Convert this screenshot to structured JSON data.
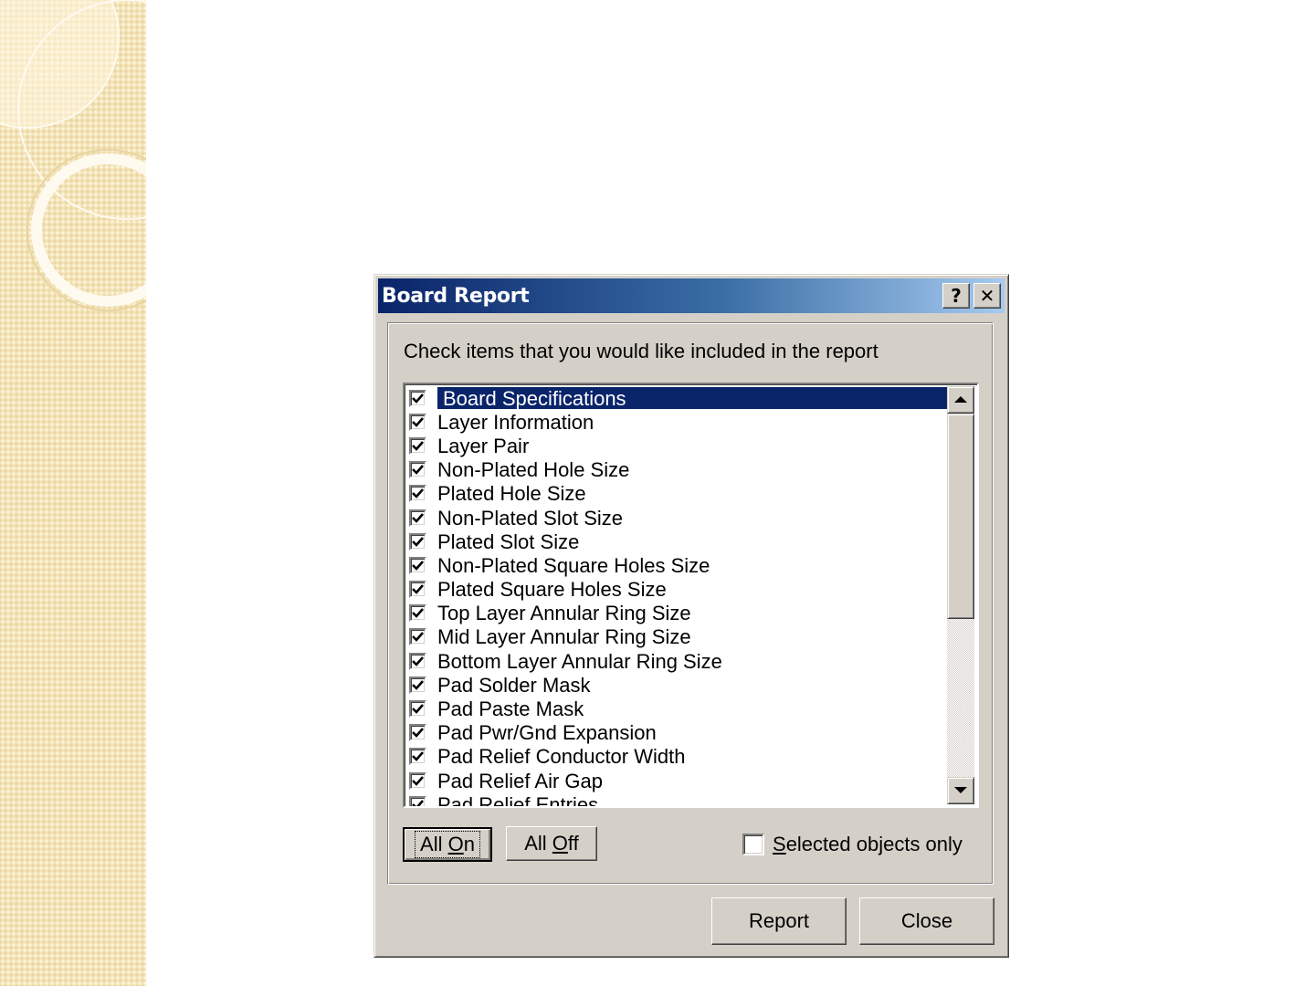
{
  "dialog": {
    "title": "Board Report",
    "help_glyph": "?",
    "close_glyph": "✕",
    "instruction": "Check items that you would like included in the report",
    "items": [
      {
        "label": "Board Specifications",
        "checked": true,
        "selected": true
      },
      {
        "label": "Layer Information",
        "checked": true
      },
      {
        "label": "Layer Pair",
        "checked": true
      },
      {
        "label": "Non-Plated Hole Size",
        "checked": true
      },
      {
        "label": "Plated Hole Size",
        "checked": true
      },
      {
        "label": "Non-Plated Slot Size",
        "checked": true
      },
      {
        "label": "Plated Slot Size",
        "checked": true
      },
      {
        "label": "Non-Plated Square Holes Size",
        "checked": true
      },
      {
        "label": "Plated Square Holes Size",
        "checked": true
      },
      {
        "label": "Top Layer Annular Ring Size",
        "checked": true
      },
      {
        "label": "Mid Layer Annular Ring Size",
        "checked": true
      },
      {
        "label": "Bottom Layer Annular Ring Size",
        "checked": true
      },
      {
        "label": "Pad Solder Mask",
        "checked": true
      },
      {
        "label": "Pad Paste Mask",
        "checked": true
      },
      {
        "label": "Pad Pwr/Gnd Expansion",
        "checked": true
      },
      {
        "label": "Pad Relief Conductor Width",
        "checked": true
      },
      {
        "label": "Pad Relief Air Gap",
        "checked": true
      },
      {
        "label": "Pad Relief Entries",
        "checked": true
      }
    ],
    "all_on": {
      "prefix": "All ",
      "mnemonic": "O",
      "rest": "n"
    },
    "all_off": {
      "prefix": "All ",
      "mnemonic": "O",
      "rest": "ff"
    },
    "selected_only": {
      "mnemonic": "S",
      "rest": "elected objects only",
      "checked": false
    },
    "report_label": "Report",
    "close_label": "Close"
  },
  "colors": {
    "titlebar_start": "#0a246a",
    "titlebar_end": "#a6caf0",
    "face": "#d4d0c8",
    "selection": "#0a246a"
  }
}
